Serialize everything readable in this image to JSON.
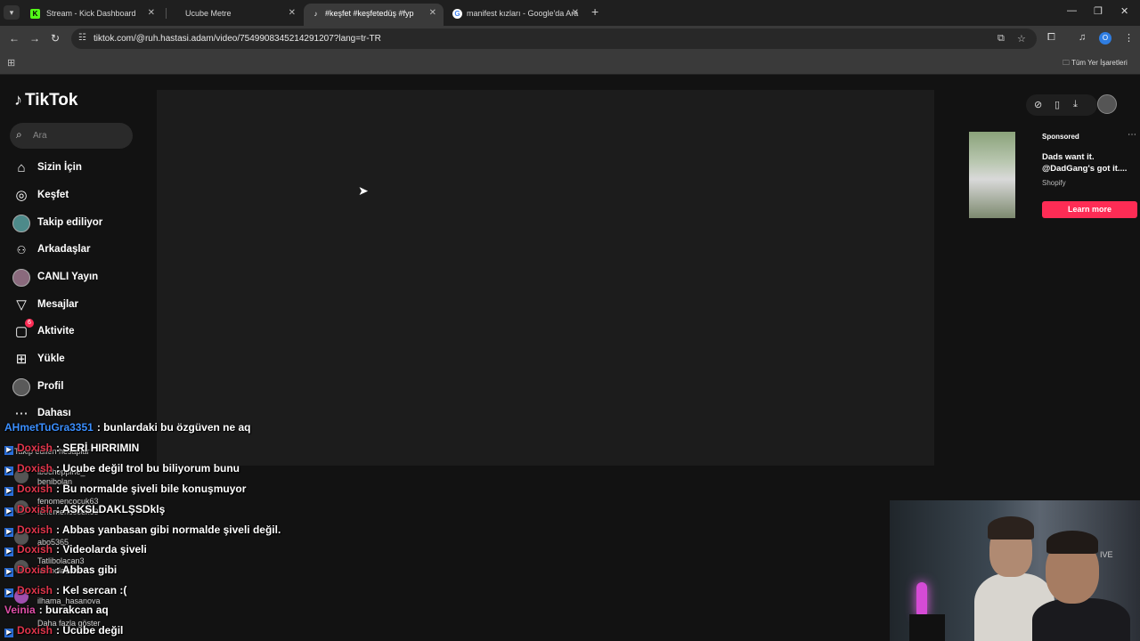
{
  "browser": {
    "tabs": [
      {
        "title": "Stream - Kick Dashboard",
        "favicon": "K",
        "active": false
      },
      {
        "title": "Ucube Metre",
        "favicon": "",
        "active": false
      },
      {
        "title": "#keşfet #keşfetedüş #fyp",
        "favicon": "♪",
        "active": true
      },
      {
        "title": "manifest kızları - Google'da Ara",
        "favicon": "G",
        "active": false
      }
    ],
    "url": "tiktok.com/@ruh.hastasi.adam/video/7549908345214291207?lang=tr-TR",
    "profile_initial": "O",
    "bookmarks_label": "Tüm Yer İşaretleri"
  },
  "tiktok": {
    "logo_text": "TikTok",
    "search_placeholder": "Ara",
    "nav": [
      {
        "label": "Sizin İçin",
        "icon": "home-icon",
        "glyph": "⌂"
      },
      {
        "label": "Keşfet",
        "icon": "compass-icon",
        "glyph": "◎"
      },
      {
        "label": "Takip ediliyor",
        "icon": "following-avatar-icon",
        "glyph": ""
      },
      {
        "label": "Arkadaşlar",
        "icon": "friends-icon",
        "glyph": "👥"
      },
      {
        "label": "CANLI Yayın",
        "icon": "live-avatar-icon",
        "glyph": ""
      },
      {
        "label": "Mesajlar",
        "icon": "send-icon",
        "glyph": "▽"
      },
      {
        "label": "Aktivite",
        "icon": "activity-icon",
        "glyph": "▢"
      },
      {
        "label": "Yükle",
        "icon": "upload-icon",
        "glyph": "⊞"
      },
      {
        "label": "Profil",
        "icon": "profile-avatar-icon",
        "glyph": ""
      },
      {
        "label": "Dahası",
        "icon": "more-icon",
        "glyph": "⋯"
      }
    ],
    "activity_badge": "6",
    "following_section_title": "Takip edilen hesaplar",
    "following_accounts": [
      {
        "name": "ibocheppine_",
        "handle": "benibolan"
      },
      {
        "name": "fenomencocuk63",
        "handle": "fenomencocuk63"
      },
      {
        "name": "abo5365",
        "handle": "abo5365"
      },
      {
        "name": "Tatlibolacan3",
        "handle": "tatlibolacan3"
      },
      {
        "name": "ilhama_hasanova",
        "handle": "ilhama_hasanova"
      }
    ],
    "show_more": "Daha fazla göster",
    "ad": {
      "sponsored": "Sponsored",
      "text": "Dads want it. @DadGang's got it....",
      "brand": "Shopify",
      "cta": "Learn more"
    }
  },
  "chat": {
    "messages": [
      {
        "user": "AHmetTuGra3351",
        "color": "#3b8fff",
        "badge": false,
        "text": ": bunlardaki bu özgüven ne aq"
      },
      {
        "user": "Doxish",
        "color": "#e0354b",
        "badge": true,
        "text": ": SERİ HIRRIMIN"
      },
      {
        "user": "Doxish",
        "color": "#e0354b",
        "badge": true,
        "text": ": Ucube değil trol bu biliyorum bunu"
      },
      {
        "user": "Doxish",
        "color": "#e0354b",
        "badge": true,
        "text": ": Bu normalde şiveli bile konuşmuyor"
      },
      {
        "user": "Doxish",
        "color": "#e0354b",
        "badge": true,
        "text": ": ASKSLDAKLŞSDklş"
      },
      {
        "user": "Doxish",
        "color": "#e0354b",
        "badge": true,
        "text": ": Abbas yanbasan gibi normalde şiveli değil."
      },
      {
        "user": "Doxish",
        "color": "#e0354b",
        "badge": true,
        "text": ": Videolarda şiveli"
      },
      {
        "user": "Doxish",
        "color": "#e0354b",
        "badge": true,
        "text": ": Abbas gibi"
      },
      {
        "user": "Doxish",
        "color": "#e0354b",
        "badge": true,
        "text": ": Kel sercan :("
      },
      {
        "user": "Veinia",
        "color": "#e04fa8",
        "badge": false,
        "text": ": burakcan aq"
      },
      {
        "user": "Doxish",
        "color": "#e0354b",
        "badge": true,
        "text": ": Ucube değil"
      }
    ]
  },
  "webcam": {
    "sign_text": "IVE"
  }
}
